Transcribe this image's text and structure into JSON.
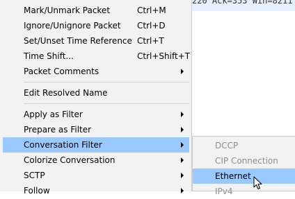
{
  "background_text": "220 Ack=353 Win=8211",
  "menu": {
    "items": [
      {
        "label": "Mark/Unmark Packet",
        "shortcut": "Ctrl+M"
      },
      {
        "label": "Ignore/Unignore Packet",
        "shortcut": "Ctrl+D"
      },
      {
        "label": "Set/Unset Time Reference",
        "shortcut": "Ctrl+T"
      },
      {
        "label": "Time Shift...",
        "shortcut": "Ctrl+Shift+T"
      },
      {
        "label": "Packet Comments",
        "submenu": true
      },
      {
        "label": "Edit Resolved Name"
      },
      {
        "label": "Apply as Filter",
        "submenu": true
      },
      {
        "label": "Prepare as Filter",
        "submenu": true
      },
      {
        "label": "Conversation Filter",
        "submenu": true,
        "highlighted": true
      },
      {
        "label": "Colorize Conversation",
        "submenu": true
      },
      {
        "label": "SCTP",
        "submenu": true
      },
      {
        "label": "Follow",
        "submenu": true
      }
    ]
  },
  "submenu": {
    "items": [
      {
        "label": "DCCP",
        "enabled": false
      },
      {
        "label": "CIP Connection",
        "enabled": false
      },
      {
        "label": "Ethernet",
        "enabled": true,
        "highlighted": true
      },
      {
        "label": "IPv4",
        "enabled": false
      }
    ]
  },
  "colors": {
    "highlight": "#99c9ff",
    "menu_bg": "#f2f2f2",
    "disabled_text": "#8f8f8f"
  },
  "icons": {
    "cursor": "mouse-pointer-icon",
    "submenu_arrow": "chevron-right-icon"
  }
}
